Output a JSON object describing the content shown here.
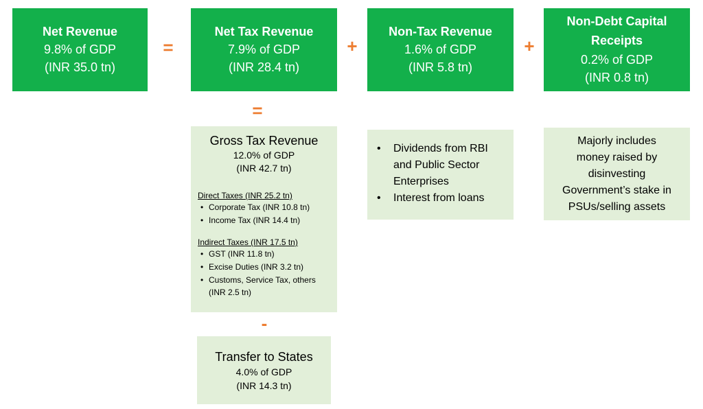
{
  "top_row": {
    "net_revenue": {
      "title": "Net Revenue",
      "gdp": "9.8% of GDP",
      "amount": "(INR 35.0 tn)"
    },
    "net_tax_revenue": {
      "title": "Net Tax Revenue",
      "gdp": "7.9% of GDP",
      "amount": "(INR 28.4 tn)"
    },
    "non_tax_revenue": {
      "title": "Non-Tax Revenue",
      "gdp": "1.6% of GDP",
      "amount": "(INR 5.8 tn)"
    },
    "non_debt_capital_receipts": {
      "title_line1": "Non-Debt Capital",
      "title_line2": "Receipts",
      "gdp": "0.2% of GDP",
      "amount": "(INR 0.8 tn)"
    }
  },
  "operators": {
    "equals": "=",
    "plus": "+",
    "minus": "-"
  },
  "gross_tax_revenue": {
    "title": "Gross Tax Revenue",
    "gdp": "12.0% of GDP",
    "amount": "(INR 42.7 tn)",
    "direct": {
      "heading": "Direct Taxes (INR 25.2 tn)",
      "items": [
        "Corporate Tax (INR 10.8 tn)",
        "Income Tax (INR 14.4 tn)"
      ]
    },
    "indirect": {
      "heading": "Indirect Taxes (INR 17.5 tn)",
      "items": [
        "GST (INR 11.8 tn)",
        "Excise Duties (INR 3.2 tn)",
        "Customs, Service Tax, others",
        "(INR 2.5 tn)"
      ]
    }
  },
  "non_tax_details": {
    "items": [
      "Dividends from RBI and Public Sector Enterprises",
      "Interest from loans"
    ]
  },
  "ndcr_details": {
    "lines": [
      "Majorly includes",
      "money raised by",
      "disinvesting",
      "Government’s stake in",
      "PSUs/selling assets"
    ]
  },
  "transfer_to_states": {
    "title": "Transfer to States",
    "gdp": "4.0% of GDP",
    "amount": "(INR 14.3 tn)"
  },
  "colors": {
    "green": "#13b04b",
    "light_green": "#e2efd9",
    "operator_orange": "#ed7d31"
  }
}
